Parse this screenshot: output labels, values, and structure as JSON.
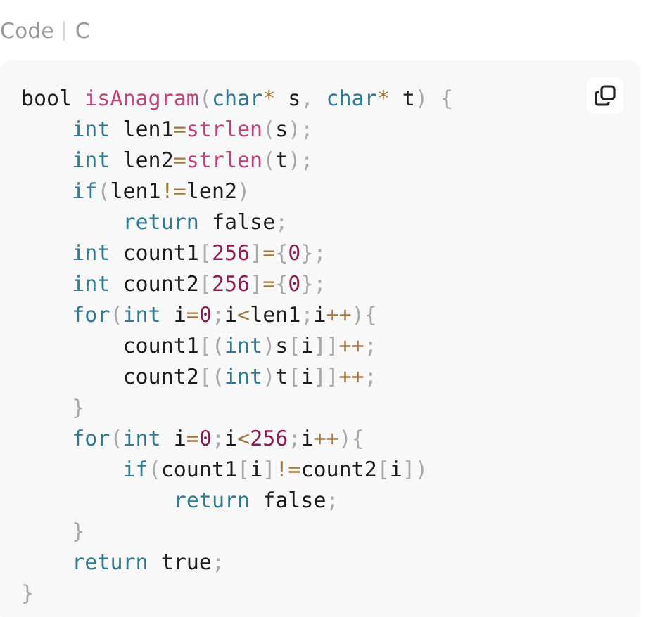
{
  "header": {
    "title": "Code",
    "language": "C"
  },
  "code_lines": [
    [
      {
        "kind": "plain",
        "text": "bool "
      },
      {
        "kind": "fn",
        "text": "isAnagram"
      },
      {
        "kind": "punct",
        "text": "("
      },
      {
        "kind": "kw",
        "text": "char"
      },
      {
        "kind": "op",
        "text": "*"
      },
      {
        "kind": "plain",
        "text": " s"
      },
      {
        "kind": "punct",
        "text": ", "
      },
      {
        "kind": "kw",
        "text": "char"
      },
      {
        "kind": "op",
        "text": "*"
      },
      {
        "kind": "plain",
        "text": " t"
      },
      {
        "kind": "punct",
        "text": ") {"
      }
    ],
    [
      {
        "kind": "kw",
        "text": "    int"
      },
      {
        "kind": "plain",
        "text": " len1"
      },
      {
        "kind": "op",
        "text": "="
      },
      {
        "kind": "fn",
        "text": "strlen"
      },
      {
        "kind": "punct",
        "text": "("
      },
      {
        "kind": "plain",
        "text": "s"
      },
      {
        "kind": "punct",
        "text": ");"
      }
    ],
    [
      {
        "kind": "kw",
        "text": "    int"
      },
      {
        "kind": "plain",
        "text": " len2"
      },
      {
        "kind": "op",
        "text": "="
      },
      {
        "kind": "fn",
        "text": "strlen"
      },
      {
        "kind": "punct",
        "text": "("
      },
      {
        "kind": "plain",
        "text": "t"
      },
      {
        "kind": "punct",
        "text": ");"
      }
    ],
    [
      {
        "kind": "kw",
        "text": "    if"
      },
      {
        "kind": "punct",
        "text": "("
      },
      {
        "kind": "plain",
        "text": "len1"
      },
      {
        "kind": "op",
        "text": "!="
      },
      {
        "kind": "plain",
        "text": "len2"
      },
      {
        "kind": "punct",
        "text": ")"
      }
    ],
    [
      {
        "kind": "kw",
        "text": "        return"
      },
      {
        "kind": "plain",
        "text": " false"
      },
      {
        "kind": "punct",
        "text": ";"
      }
    ],
    [
      {
        "kind": "kw",
        "text": "    int"
      },
      {
        "kind": "plain",
        "text": " count1"
      },
      {
        "kind": "punct",
        "text": "["
      },
      {
        "kind": "num",
        "text": "256"
      },
      {
        "kind": "punct",
        "text": "]"
      },
      {
        "kind": "op",
        "text": "="
      },
      {
        "kind": "punct",
        "text": "{"
      },
      {
        "kind": "num",
        "text": "0"
      },
      {
        "kind": "punct",
        "text": "};"
      }
    ],
    [
      {
        "kind": "kw",
        "text": "    int"
      },
      {
        "kind": "plain",
        "text": " count2"
      },
      {
        "kind": "punct",
        "text": "["
      },
      {
        "kind": "num",
        "text": "256"
      },
      {
        "kind": "punct",
        "text": "]"
      },
      {
        "kind": "op",
        "text": "="
      },
      {
        "kind": "punct",
        "text": "{"
      },
      {
        "kind": "num",
        "text": "0"
      },
      {
        "kind": "punct",
        "text": "};"
      }
    ],
    [
      {
        "kind": "kw",
        "text": "    for"
      },
      {
        "kind": "punct",
        "text": "("
      },
      {
        "kind": "kw",
        "text": "int"
      },
      {
        "kind": "plain",
        "text": " i"
      },
      {
        "kind": "op",
        "text": "="
      },
      {
        "kind": "num",
        "text": "0"
      },
      {
        "kind": "punct",
        "text": ";"
      },
      {
        "kind": "plain",
        "text": "i"
      },
      {
        "kind": "op",
        "text": "<"
      },
      {
        "kind": "plain",
        "text": "len1"
      },
      {
        "kind": "punct",
        "text": ";"
      },
      {
        "kind": "plain",
        "text": "i"
      },
      {
        "kind": "op",
        "text": "++"
      },
      {
        "kind": "punct",
        "text": "){"
      }
    ],
    [
      {
        "kind": "plain",
        "text": "        count1"
      },
      {
        "kind": "punct",
        "text": "[("
      },
      {
        "kind": "kw",
        "text": "int"
      },
      {
        "kind": "punct",
        "text": ")"
      },
      {
        "kind": "plain",
        "text": "s"
      },
      {
        "kind": "punct",
        "text": "["
      },
      {
        "kind": "plain",
        "text": "i"
      },
      {
        "kind": "punct",
        "text": "]]"
      },
      {
        "kind": "op",
        "text": "++"
      },
      {
        "kind": "punct",
        "text": ";"
      }
    ],
    [
      {
        "kind": "plain",
        "text": "        count2"
      },
      {
        "kind": "punct",
        "text": "[("
      },
      {
        "kind": "kw",
        "text": "int"
      },
      {
        "kind": "punct",
        "text": ")"
      },
      {
        "kind": "plain",
        "text": "t"
      },
      {
        "kind": "punct",
        "text": "["
      },
      {
        "kind": "plain",
        "text": "i"
      },
      {
        "kind": "punct",
        "text": "]]"
      },
      {
        "kind": "op",
        "text": "++"
      },
      {
        "kind": "punct",
        "text": ";"
      }
    ],
    [
      {
        "kind": "punct",
        "text": "    }"
      }
    ],
    [
      {
        "kind": "kw",
        "text": "    for"
      },
      {
        "kind": "punct",
        "text": "("
      },
      {
        "kind": "kw",
        "text": "int"
      },
      {
        "kind": "plain",
        "text": " i"
      },
      {
        "kind": "op",
        "text": "="
      },
      {
        "kind": "num",
        "text": "0"
      },
      {
        "kind": "punct",
        "text": ";"
      },
      {
        "kind": "plain",
        "text": "i"
      },
      {
        "kind": "op",
        "text": "<"
      },
      {
        "kind": "num",
        "text": "256"
      },
      {
        "kind": "punct",
        "text": ";"
      },
      {
        "kind": "plain",
        "text": "i"
      },
      {
        "kind": "op",
        "text": "++"
      },
      {
        "kind": "punct",
        "text": "){"
      }
    ],
    [
      {
        "kind": "kw",
        "text": "        if"
      },
      {
        "kind": "punct",
        "text": "("
      },
      {
        "kind": "plain",
        "text": "count1"
      },
      {
        "kind": "punct",
        "text": "["
      },
      {
        "kind": "plain",
        "text": "i"
      },
      {
        "kind": "punct",
        "text": "]"
      },
      {
        "kind": "op",
        "text": "!="
      },
      {
        "kind": "plain",
        "text": "count2"
      },
      {
        "kind": "punct",
        "text": "["
      },
      {
        "kind": "plain",
        "text": "i"
      },
      {
        "kind": "punct",
        "text": "])"
      }
    ],
    [
      {
        "kind": "kw",
        "text": "            return"
      },
      {
        "kind": "plain",
        "text": " false"
      },
      {
        "kind": "punct",
        "text": ";"
      }
    ],
    [
      {
        "kind": "punct",
        "text": "    }"
      }
    ],
    [
      {
        "kind": "kw",
        "text": "    return"
      },
      {
        "kind": "plain",
        "text": " true"
      },
      {
        "kind": "punct",
        "text": ";"
      }
    ],
    [
      {
        "kind": "punct",
        "text": "}"
      }
    ]
  ]
}
